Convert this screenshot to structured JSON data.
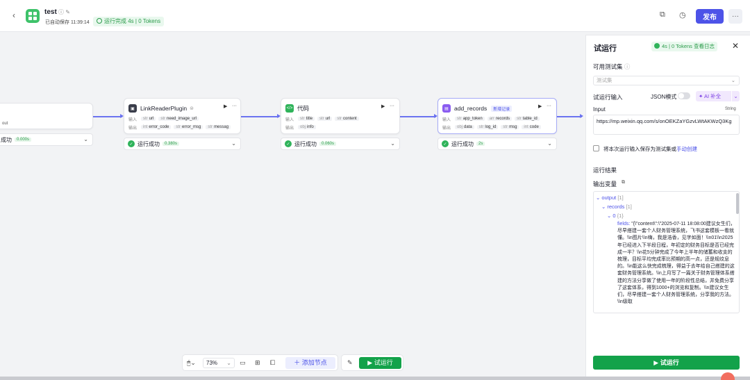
{
  "header": {
    "app_name": "test",
    "autosave": "已自动保存 11:39:14",
    "run_status": "运行完成 4s | 0 Tokens",
    "publish_label": "发布",
    "more_label": "···"
  },
  "nodes": [
    {
      "id": "start",
      "output_fragment": "out",
      "status_label": "成功",
      "duration": "0.000s"
    },
    {
      "id": "link_reader",
      "title": "LinkReaderPlugin",
      "input_label": "输入",
      "inputs": [
        {
          "type": "str",
          "name": "url"
        },
        {
          "type": "str",
          "name": "need_image_url"
        }
      ],
      "output_label": "输出",
      "outputs": [
        {
          "type": "int",
          "name": "error_code"
        },
        {
          "type": "str",
          "name": "error_msg"
        },
        {
          "type": "str",
          "name": "messag"
        }
      ],
      "status_label": "运行成功",
      "duration": "0.380s"
    },
    {
      "id": "code",
      "title": "代码",
      "input_label": "输入",
      "inputs": [
        {
          "type": "str",
          "name": "title"
        },
        {
          "type": "str",
          "name": "url"
        },
        {
          "type": "str",
          "name": "content"
        }
      ],
      "output_label": "输出",
      "outputs": [
        {
          "type": "obj",
          "name": "info"
        }
      ],
      "status_label": "运行成功",
      "duration": "0.060s"
    },
    {
      "id": "add_records",
      "title": "add_records",
      "tag": "新增记录",
      "input_label": "输入",
      "inputs": [
        {
          "type": "str",
          "name": "app_token"
        },
        {
          "type": "arr",
          "name": "records"
        },
        {
          "type": "str",
          "name": "table_id"
        }
      ],
      "output_label": "输出",
      "outputs": [
        {
          "type": "obj",
          "name": "data"
        },
        {
          "type": "str",
          "name": "log_id"
        },
        {
          "type": "str",
          "name": "msg"
        },
        {
          "type": "int",
          "name": "code"
        }
      ],
      "status_label": "运行成功",
      "duration": "2s"
    }
  ],
  "toolbar": {
    "zoom": "73%",
    "add_node_label": "添加节点",
    "trial_run_label": "试运行"
  },
  "panel": {
    "title": "试运行",
    "badge": "4s | 0 Tokens",
    "log_link": "查看日志",
    "testset_label": "可用测试集",
    "testset_placeholder": "测试集",
    "trial_input_label": "试运行输入",
    "json_mode_label": "JSON模式",
    "ai_fill_label": "AI 补全",
    "input_label": "Input",
    "input_type": "String",
    "input_value": "https://mp.weixin.qq.com/s/onOEKZaYGzvLWtAKWzQ3Kg",
    "save_text": "将本次运行输入保存为测试集或",
    "save_link": "手动创建",
    "result_label": "运行结果",
    "output_vars_label": "输出变量",
    "tree": {
      "output_key": "output",
      "output_count": "[1]",
      "records_key": "records",
      "records_count": "[1]",
      "index_key": "0",
      "index_count": "{1}",
      "fields_key": "fields:",
      "fields_value": "\"{\\\"content\\\":\\\"2025-07-11 18:08:00建议女生们，尽早搭建一套个人财务管理系统，飞书这套模板一看就懂。\\\\n图片\\\\n嗨，我是浩香，见字如面！\\\\n01\\\\n2025年已经进入下半段日程，年初定的财务目标是否已经完成一半？\\\\n花5分钟完成了今年上半年的储蓄和收支的梳理，目标平均完成率比预期的高一点，还是规纹息的。\\\\n能这么快完成梳理，得益于去年给自己搭建的这套财务管理系统。\\\\n上月写了一篇关于财务管理体系搭建的方法分享做了使用一年的阶段性总结，并免费分享了这套体系，得到1000+的浏览和复制。\\\\n建议女生们，尽早搭建一套个人财务管理系统，分享我的方法。\\\\n级取"
    },
    "run_button_label": "试运行"
  }
}
